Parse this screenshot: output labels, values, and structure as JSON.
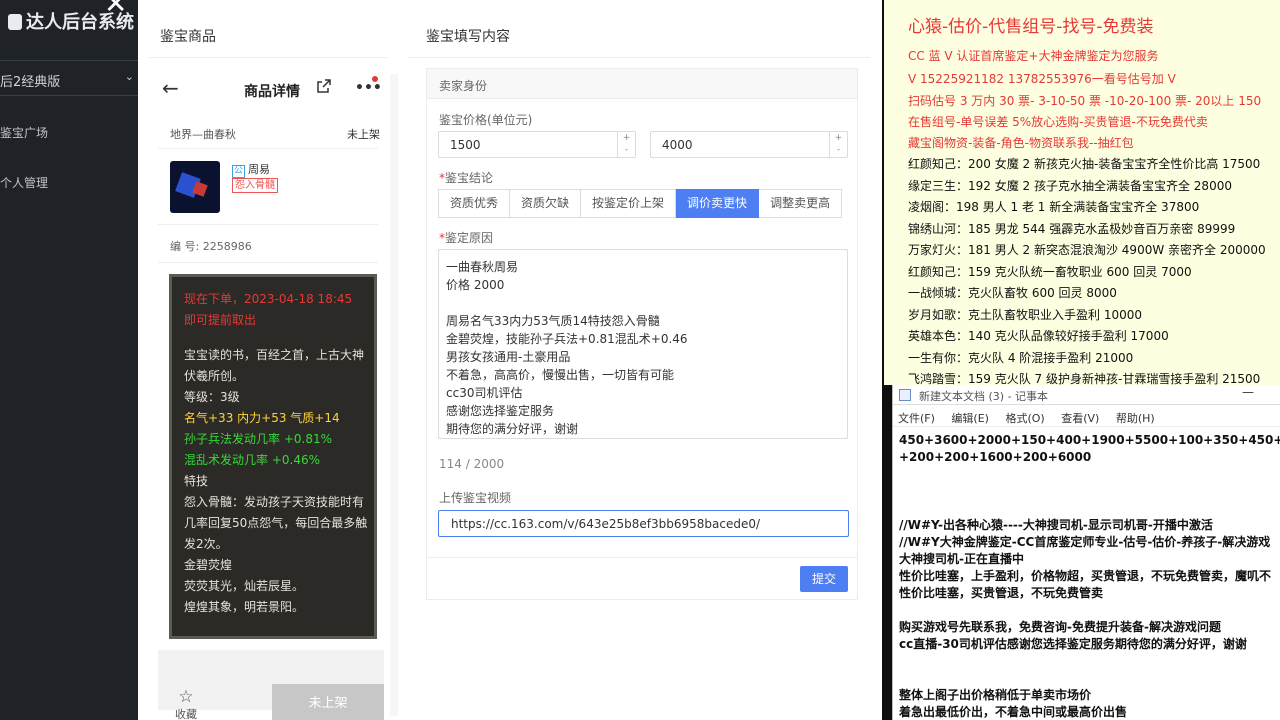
{
  "sidebar": {
    "brand": "达人后台系统",
    "selector": "后2经典版",
    "nav": [
      "鉴宝广场",
      "个人管理"
    ]
  },
  "modal": {
    "left_title": "鉴宝商品",
    "right_title": "鉴宝填写内容"
  },
  "phone": {
    "title": "商品详情",
    "seller": "地界—曲春秋",
    "status": "未上架",
    "seller_name": "周易",
    "tag": "怨入骨髓",
    "code": "编 号: 2258986",
    "card": {
      "line1": "现在下单，2023-04-18 18:45",
      "line2": "即可提前取出",
      "desc": "宝宝读的书，百经之首，上古大神伏羲所创。",
      "level": "等级：3级",
      "stats": "名气+33 内力+53 气质+14",
      "sk1": "孙子兵法发动几率 +0.81%",
      "sk2": "混乱术发动几率 +0.46%",
      "special": "特技",
      "special_desc": "怨入骨髓：发动孩子天资技能时有几率回复50点怨气，每回合最多触发2次。",
      "item": "金碧荧煌",
      "item_desc1": "荧荧其光，灿若辰星。",
      "item_desc2": "煌煌其象，明若景阳。"
    },
    "fav": "收藏",
    "unlist": "未上架"
  },
  "form": {
    "section": "卖家身份",
    "price_label": "鉴宝价格(单位元)",
    "price_min": "1500",
    "price_max": "4000",
    "conclusion_label": "鉴宝结论",
    "options": [
      "资质优秀",
      "资质欠缺",
      "按鉴定价上架",
      "调价卖更快",
      "调整卖更高"
    ],
    "selected": 3,
    "reason_label": "鉴定原因",
    "reason": "一曲春秋周易\n价格 2000\n\n周易名气33内力53气质14特技怨入骨髓\n金碧荧煌，技能孙子兵法+0.81混乱术+0.46\n男孩女孩通用-土豪用品\n不着急，高高价，慢慢出售，一切皆有可能\ncc30司机评估\n感谢您选择鉴定服务\n期待您的满分好评，谢谢",
    "count": "114 / 2000",
    "video_label": "上传鉴宝视频",
    "video_url": "https://cc.163.com/v/643e25b8ef3bb6958bacede0/",
    "submit": "提交"
  },
  "ad": {
    "title": "心猿-估价-代售组号-找号-免费装",
    "red_lines": [
      "CC 蓝 V 认证首席鉴定+大神金牌鉴定为您服务",
      "V 15225921182     13782553976一看号估号加 V",
      "扫码估号 3 万内 30 票- 3-10-50 票 -10-20-100 票- 20以上 150",
      "在售组号-单号误差 5%放心选购-买贵管退-不玩免费代卖",
      "藏宝阁物资-装备-角色-物资联系我--抽红包"
    ],
    "list": [
      "红颜知己：200 女魔 2 新孩克火抽-装备宝宝齐全性价比高 17500",
      "缘定三生：192 女魔 2 孩子克水抽全满装备宝宝齐全 28000",
      "凌烟阁：198 男人 1 老 1 新全满装备宝宝齐全 37800",
      "锦绣山河：185 男龙 544 强霹克水孟极妙音百万亲密 89999",
      "万家灯火：181 男人 2 新突态混浪淘沙 4900W 亲密齐全 200000",
      "红颜知己：159 克火队统一畜牧职业 600 回灵 7000",
      "一战倾城：克火队畜牧 600 回灵 8000",
      "岁月如歌：克土队畜牧职业入手盈利 10000",
      "英雄本色：140 克火队品像较好接手盈利 17000",
      "一生有你：克火队 4 阶混接手盈利 21000",
      "飞鸿踏雪：159 克火队 7 级护身新神孩-甘霖瑞雪接手盈利 21500"
    ]
  },
  "notepad": {
    "title": "新建文本文档 (3) - 记事本",
    "menu": [
      "文件(F)",
      "编辑(E)",
      "格式(O)",
      "查看(V)",
      "帮助(H)"
    ],
    "text": "450+3600+2000+150+400+1900+5500+100+350+450+30\n+200+200+1600+200+6000\n\n\n\n//W#Y-出各种心猿----大神搜司机-显示司机哥-开播中激活\n//W#Y大神金牌鉴定-CC首席鉴定师专业-估号-估价-养孩子-解决游戏\n大神搜司机-正在直播中\n性价比哇塞，上手盈利，价格物超，买贵管退，不玩免费管卖，魔叽不\n性价比哇塞，买贵管退，不玩免费管卖\n\n购买游戏号先联系我，免费咨询-免费提升装备-解决游戏问题\ncc直播-30司机评估感谢您选择鉴定服务期待您的满分好评，谢谢\n\n\n整体上阁子出价格稍低于单卖市场价\n着急出最低价出，不着急中间或最高价出售"
  }
}
